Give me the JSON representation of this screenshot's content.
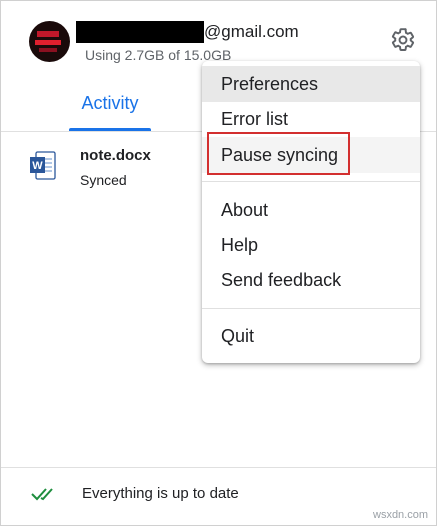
{
  "account": {
    "email_suffix": "@gmail.com",
    "usage": "Using 2.7GB of 15.0GB"
  },
  "tabs": [
    {
      "label": "Activity",
      "active": true
    }
  ],
  "files": [
    {
      "name": "note.docx",
      "status": "Synced",
      "icon": "word-doc-icon"
    }
  ],
  "menu": {
    "group1": [
      "Preferences",
      "Error list",
      "Pause syncing"
    ],
    "group2": [
      "About",
      "Help",
      "Send feedback"
    ],
    "group3": [
      "Quit"
    ],
    "highlighted": "Preferences"
  },
  "footer": {
    "status": "Everything is up to date",
    "icon": "double-check-icon"
  },
  "colors": {
    "accent": "#1a73e8",
    "highlight_box": "#d32f2f",
    "check": "#1e8e3e"
  },
  "watermark": "wsxdn.com"
}
